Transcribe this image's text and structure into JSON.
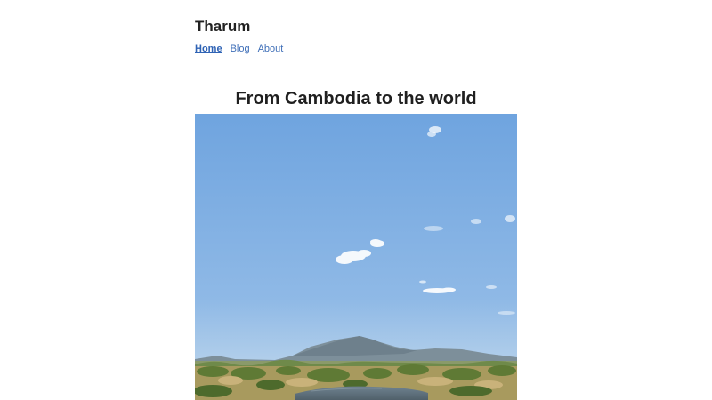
{
  "site": {
    "title": "Tharum"
  },
  "nav": {
    "items": [
      {
        "label": "Home",
        "active": true
      },
      {
        "label": "Blog",
        "active": false
      },
      {
        "label": "About",
        "active": false
      }
    ]
  },
  "main": {
    "title": "From Cambodia to the world"
  },
  "colors": {
    "link": "#3f6fb8",
    "sky_top": "#6fa4df",
    "sky_bottom": "#c7dced"
  }
}
